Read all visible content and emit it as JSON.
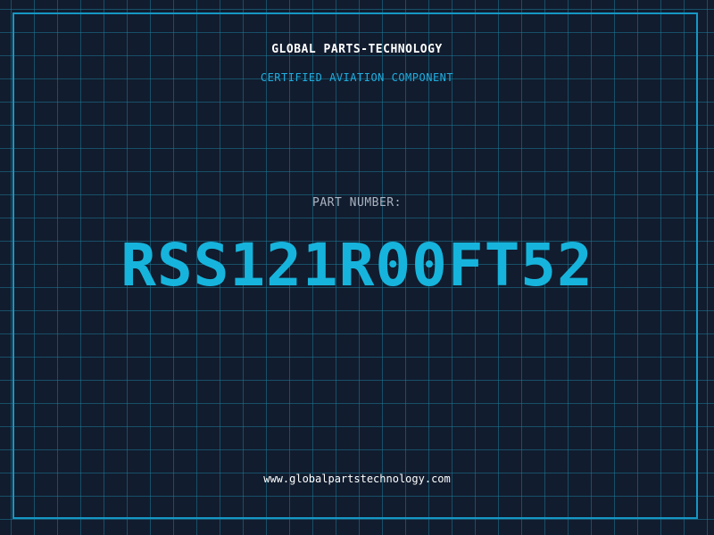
{
  "header": {
    "company": "GLOBAL PARTS-TECHNOLOGY",
    "subtitle": "CERTIFIED AVIATION COMPONENT"
  },
  "part": {
    "label": "PART NUMBER:",
    "number": "RSS121R00FT52"
  },
  "footer": {
    "website": "www.globalpartstechnology.com"
  },
  "colors": {
    "background": "#111c2e",
    "grid": "#1c7896",
    "frame": "#1597c4",
    "accent": "#16b4dc",
    "subtitle": "#1eaee0",
    "label": "#aab3c0",
    "text": "#ffffff"
  }
}
